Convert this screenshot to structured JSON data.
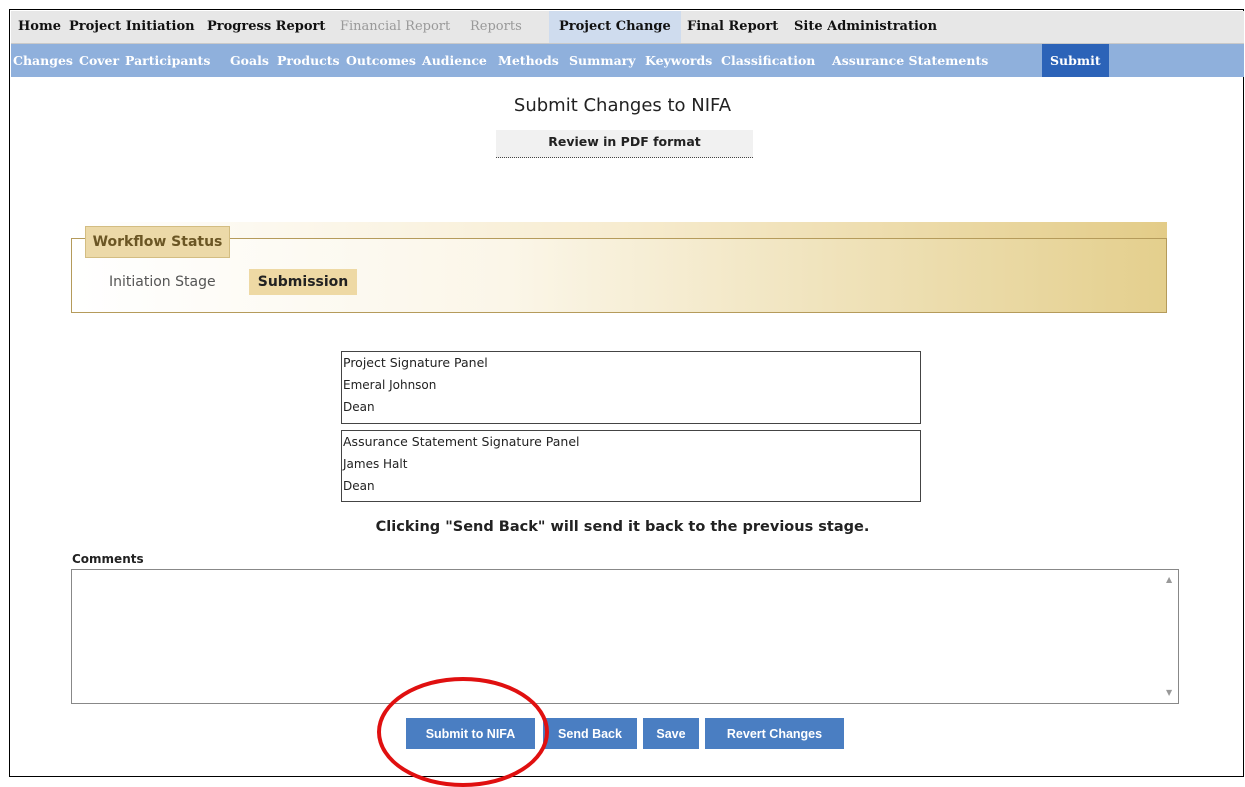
{
  "top_nav": [
    {
      "label": "Home"
    },
    {
      "label": "Project Initiation"
    },
    {
      "label": "Progress Report"
    },
    {
      "label": "Financial Report"
    },
    {
      "label": "Reports"
    },
    {
      "label": "Project Change"
    },
    {
      "label": "Final Report"
    },
    {
      "label": "Site Administration"
    }
  ],
  "sub_nav": [
    {
      "label": "Changes"
    },
    {
      "label": "Cover"
    },
    {
      "label": "Participants"
    },
    {
      "label": "Goals"
    },
    {
      "label": "Products"
    },
    {
      "label": "Outcomes"
    },
    {
      "label": "Audience"
    },
    {
      "label": "Methods"
    },
    {
      "label": "Summary"
    },
    {
      "label": "Keywords"
    },
    {
      "label": "Classification"
    },
    {
      "label": "Assurance Statements"
    },
    {
      "label": "Submit"
    }
  ],
  "page": {
    "title": "Submit Changes to NIFA",
    "pdf_link": "Review in PDF format"
  },
  "workflow": {
    "legend": "Workflow Status",
    "stages": [
      "Initiation Stage",
      "Submission"
    ],
    "current_stage": "Submission"
  },
  "signature_panels": [
    {
      "title": "Project Signature Panel",
      "name": "Emeral Johnson",
      "role": "Dean"
    },
    {
      "title": "Assurance Statement Signature Panel",
      "name": "James Halt",
      "role": "Dean"
    }
  ],
  "send_back_note": "Clicking \"Send Back\" will send it back to the previous stage.",
  "comments": {
    "label": "Comments",
    "value": ""
  },
  "buttons": {
    "submit": "Submit to NIFA",
    "send_back": "Send Back",
    "save": "Save",
    "revert": "Revert Changes"
  },
  "colors": {
    "active_subtab": "#2c63b8",
    "subnav_bg": "#8fb0dc",
    "button_bg": "#4a7ec2",
    "workflow_gold": "#e4cf8d",
    "highlight_ring": "#e01010"
  }
}
